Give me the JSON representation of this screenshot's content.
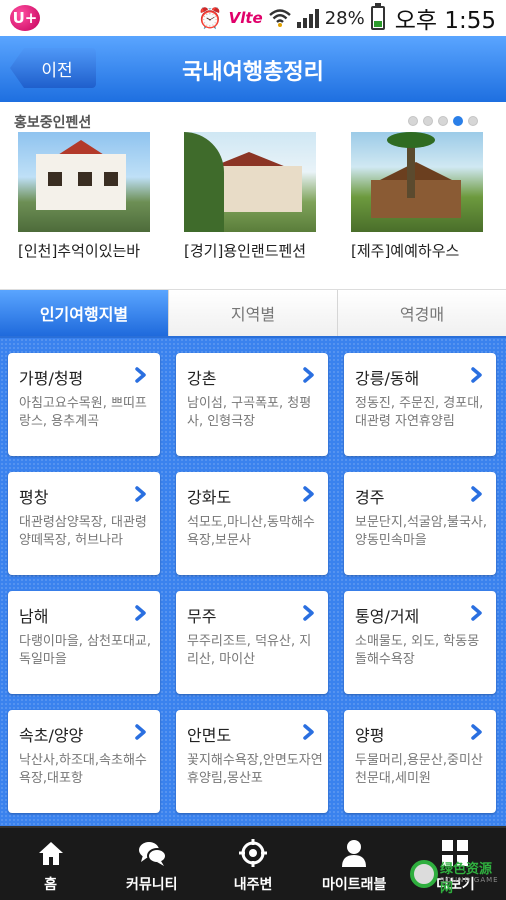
{
  "status_bar": {
    "carrier_logo": "U+",
    "network": "Vlte",
    "battery_percent": "28%",
    "time": "오후 1:55",
    "battery_level": 0.28,
    "icons": [
      "alarm-icon",
      "wifi-icon",
      "signal-icon",
      "battery-icon"
    ]
  },
  "header": {
    "back_label": "이전",
    "title": "국내여행총정리",
    "color": "#2a7fe8"
  },
  "promo": {
    "title": "홍보중인펜션",
    "page_count": 5,
    "active_page": 4,
    "items": [
      {
        "label": "[인천]추억이있는바"
      },
      {
        "label": "[경기]용인랜드펜션"
      },
      {
        "label": "[제주]예예하우스"
      }
    ]
  },
  "tabs": [
    {
      "label": "인기여행지별",
      "active": true
    },
    {
      "label": "지역별",
      "active": false
    },
    {
      "label": "역경매",
      "active": false
    }
  ],
  "destinations": [
    {
      "name": "가평/청평",
      "desc": "아침고요수목원, 쁘띠프랑스, 용추계곡"
    },
    {
      "name": "강촌",
      "desc": "남이섬, 구곡폭포, 청평사, 인형극장"
    },
    {
      "name": "강릉/동해",
      "desc": "정동진, 주문진, 경포대, 대관령 자연휴양림"
    },
    {
      "name": "평창",
      "desc": "대관령삼양목장, 대관령양떼목장, 허브나라"
    },
    {
      "name": "강화도",
      "desc": "석모도,마니산,동막해수욕장,보문사"
    },
    {
      "name": "경주",
      "desc": "보문단지,석굴암,불국사,양동민속마을"
    },
    {
      "name": "남해",
      "desc": "다랭이마을, 삼천포대교, 독일마을"
    },
    {
      "name": "무주",
      "desc": "무주리조트, 덕유산, 지리산, 마이산"
    },
    {
      "name": "통영/거제",
      "desc": "소매물도, 외도, 학동몽돌해수욕장"
    },
    {
      "name": "속초/양양",
      "desc": "낙산사,하조대,속초해수욕장,대포항"
    },
    {
      "name": "안면도",
      "desc": "꽃지해수욕장,안면도자연휴양림,몽산포"
    },
    {
      "name": "양평",
      "desc": "두물머리,용문산,중미산천문대,세미원"
    }
  ],
  "bottom_nav": [
    {
      "label": "홈",
      "icon": "home-icon"
    },
    {
      "label": "커뮤니티",
      "icon": "chat-icon"
    },
    {
      "label": "내주변",
      "icon": "location-target-icon"
    },
    {
      "label": "마이트래블",
      "icon": "person-icon"
    },
    {
      "label": "더보기",
      "icon": "grid-icon"
    }
  ],
  "watermark": {
    "text": "绿色资源网",
    "sub": "SOUND GAME"
  }
}
